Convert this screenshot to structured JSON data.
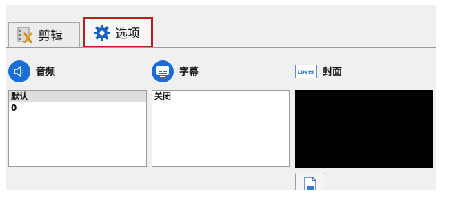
{
  "tabs": {
    "edit_label": "剪辑",
    "options_label": "选项",
    "selected": "选项"
  },
  "audio": {
    "title": "音频",
    "list_header": "默认",
    "items": [
      "0"
    ]
  },
  "subtitle": {
    "title": "字幕",
    "list_header": "关闭"
  },
  "cover": {
    "title": "封面",
    "icon_text": "cover"
  },
  "colors": {
    "accent": "#1a6ed6",
    "highlight_border": "#c11b1b",
    "cover_fill": "#000000"
  },
  "icons": {
    "edit_tab": "film-scissors-icon",
    "options_tab": "gear-icon",
    "audio": "speaker-icon",
    "subtitle": "subtitle-icon",
    "cover": "cover-icon",
    "file_button": "document-icon"
  }
}
